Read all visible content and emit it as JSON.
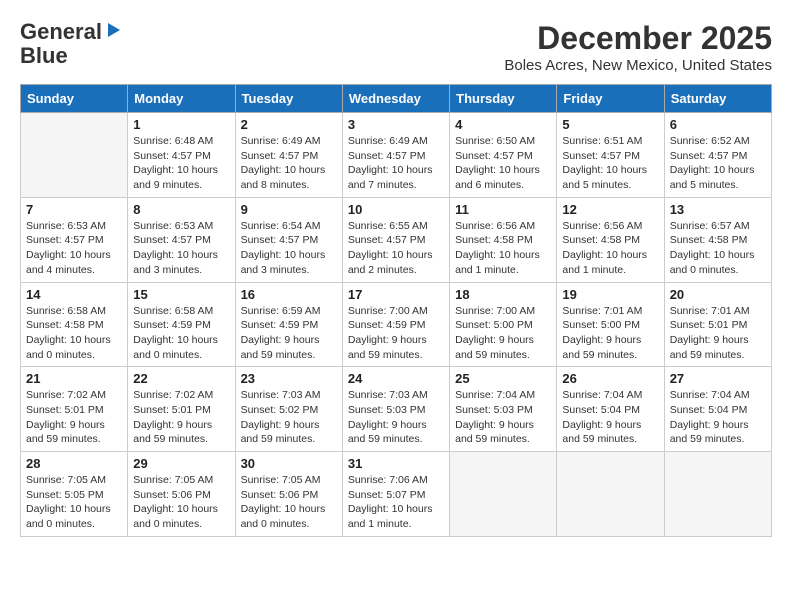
{
  "logo": {
    "line1": "General",
    "line2": "Blue"
  },
  "title": "December 2025",
  "location": "Boles Acres, New Mexico, United States",
  "headers": [
    "Sunday",
    "Monday",
    "Tuesday",
    "Wednesday",
    "Thursday",
    "Friday",
    "Saturday"
  ],
  "weeks": [
    [
      {
        "day": "",
        "detail": ""
      },
      {
        "day": "1",
        "detail": "Sunrise: 6:48 AM\nSunset: 4:57 PM\nDaylight: 10 hours\nand 9 minutes."
      },
      {
        "day": "2",
        "detail": "Sunrise: 6:49 AM\nSunset: 4:57 PM\nDaylight: 10 hours\nand 8 minutes."
      },
      {
        "day": "3",
        "detail": "Sunrise: 6:49 AM\nSunset: 4:57 PM\nDaylight: 10 hours\nand 7 minutes."
      },
      {
        "day": "4",
        "detail": "Sunrise: 6:50 AM\nSunset: 4:57 PM\nDaylight: 10 hours\nand 6 minutes."
      },
      {
        "day": "5",
        "detail": "Sunrise: 6:51 AM\nSunset: 4:57 PM\nDaylight: 10 hours\nand 5 minutes."
      },
      {
        "day": "6",
        "detail": "Sunrise: 6:52 AM\nSunset: 4:57 PM\nDaylight: 10 hours\nand 5 minutes."
      }
    ],
    [
      {
        "day": "7",
        "detail": "Sunrise: 6:53 AM\nSunset: 4:57 PM\nDaylight: 10 hours\nand 4 minutes."
      },
      {
        "day": "8",
        "detail": "Sunrise: 6:53 AM\nSunset: 4:57 PM\nDaylight: 10 hours\nand 3 minutes."
      },
      {
        "day": "9",
        "detail": "Sunrise: 6:54 AM\nSunset: 4:57 PM\nDaylight: 10 hours\nand 3 minutes."
      },
      {
        "day": "10",
        "detail": "Sunrise: 6:55 AM\nSunset: 4:57 PM\nDaylight: 10 hours\nand 2 minutes."
      },
      {
        "day": "11",
        "detail": "Sunrise: 6:56 AM\nSunset: 4:58 PM\nDaylight: 10 hours\nand 1 minute."
      },
      {
        "day": "12",
        "detail": "Sunrise: 6:56 AM\nSunset: 4:58 PM\nDaylight: 10 hours\nand 1 minute."
      },
      {
        "day": "13",
        "detail": "Sunrise: 6:57 AM\nSunset: 4:58 PM\nDaylight: 10 hours\nand 0 minutes."
      }
    ],
    [
      {
        "day": "14",
        "detail": "Sunrise: 6:58 AM\nSunset: 4:58 PM\nDaylight: 10 hours\nand 0 minutes."
      },
      {
        "day": "15",
        "detail": "Sunrise: 6:58 AM\nSunset: 4:59 PM\nDaylight: 10 hours\nand 0 minutes."
      },
      {
        "day": "16",
        "detail": "Sunrise: 6:59 AM\nSunset: 4:59 PM\nDaylight: 9 hours\nand 59 minutes."
      },
      {
        "day": "17",
        "detail": "Sunrise: 7:00 AM\nSunset: 4:59 PM\nDaylight: 9 hours\nand 59 minutes."
      },
      {
        "day": "18",
        "detail": "Sunrise: 7:00 AM\nSunset: 5:00 PM\nDaylight: 9 hours\nand 59 minutes."
      },
      {
        "day": "19",
        "detail": "Sunrise: 7:01 AM\nSunset: 5:00 PM\nDaylight: 9 hours\nand 59 minutes."
      },
      {
        "day": "20",
        "detail": "Sunrise: 7:01 AM\nSunset: 5:01 PM\nDaylight: 9 hours\nand 59 minutes."
      }
    ],
    [
      {
        "day": "21",
        "detail": "Sunrise: 7:02 AM\nSunset: 5:01 PM\nDaylight: 9 hours\nand 59 minutes."
      },
      {
        "day": "22",
        "detail": "Sunrise: 7:02 AM\nSunset: 5:01 PM\nDaylight: 9 hours\nand 59 minutes."
      },
      {
        "day": "23",
        "detail": "Sunrise: 7:03 AM\nSunset: 5:02 PM\nDaylight: 9 hours\nand 59 minutes."
      },
      {
        "day": "24",
        "detail": "Sunrise: 7:03 AM\nSunset: 5:03 PM\nDaylight: 9 hours\nand 59 minutes."
      },
      {
        "day": "25",
        "detail": "Sunrise: 7:04 AM\nSunset: 5:03 PM\nDaylight: 9 hours\nand 59 minutes."
      },
      {
        "day": "26",
        "detail": "Sunrise: 7:04 AM\nSunset: 5:04 PM\nDaylight: 9 hours\nand 59 minutes."
      },
      {
        "day": "27",
        "detail": "Sunrise: 7:04 AM\nSunset: 5:04 PM\nDaylight: 9 hours\nand 59 minutes."
      }
    ],
    [
      {
        "day": "28",
        "detail": "Sunrise: 7:05 AM\nSunset: 5:05 PM\nDaylight: 10 hours\nand 0 minutes."
      },
      {
        "day": "29",
        "detail": "Sunrise: 7:05 AM\nSunset: 5:06 PM\nDaylight: 10 hours\nand 0 minutes."
      },
      {
        "day": "30",
        "detail": "Sunrise: 7:05 AM\nSunset: 5:06 PM\nDaylight: 10 hours\nand 0 minutes."
      },
      {
        "day": "31",
        "detail": "Sunrise: 7:06 AM\nSunset: 5:07 PM\nDaylight: 10 hours\nand 1 minute."
      },
      {
        "day": "",
        "detail": ""
      },
      {
        "day": "",
        "detail": ""
      },
      {
        "day": "",
        "detail": ""
      }
    ]
  ]
}
